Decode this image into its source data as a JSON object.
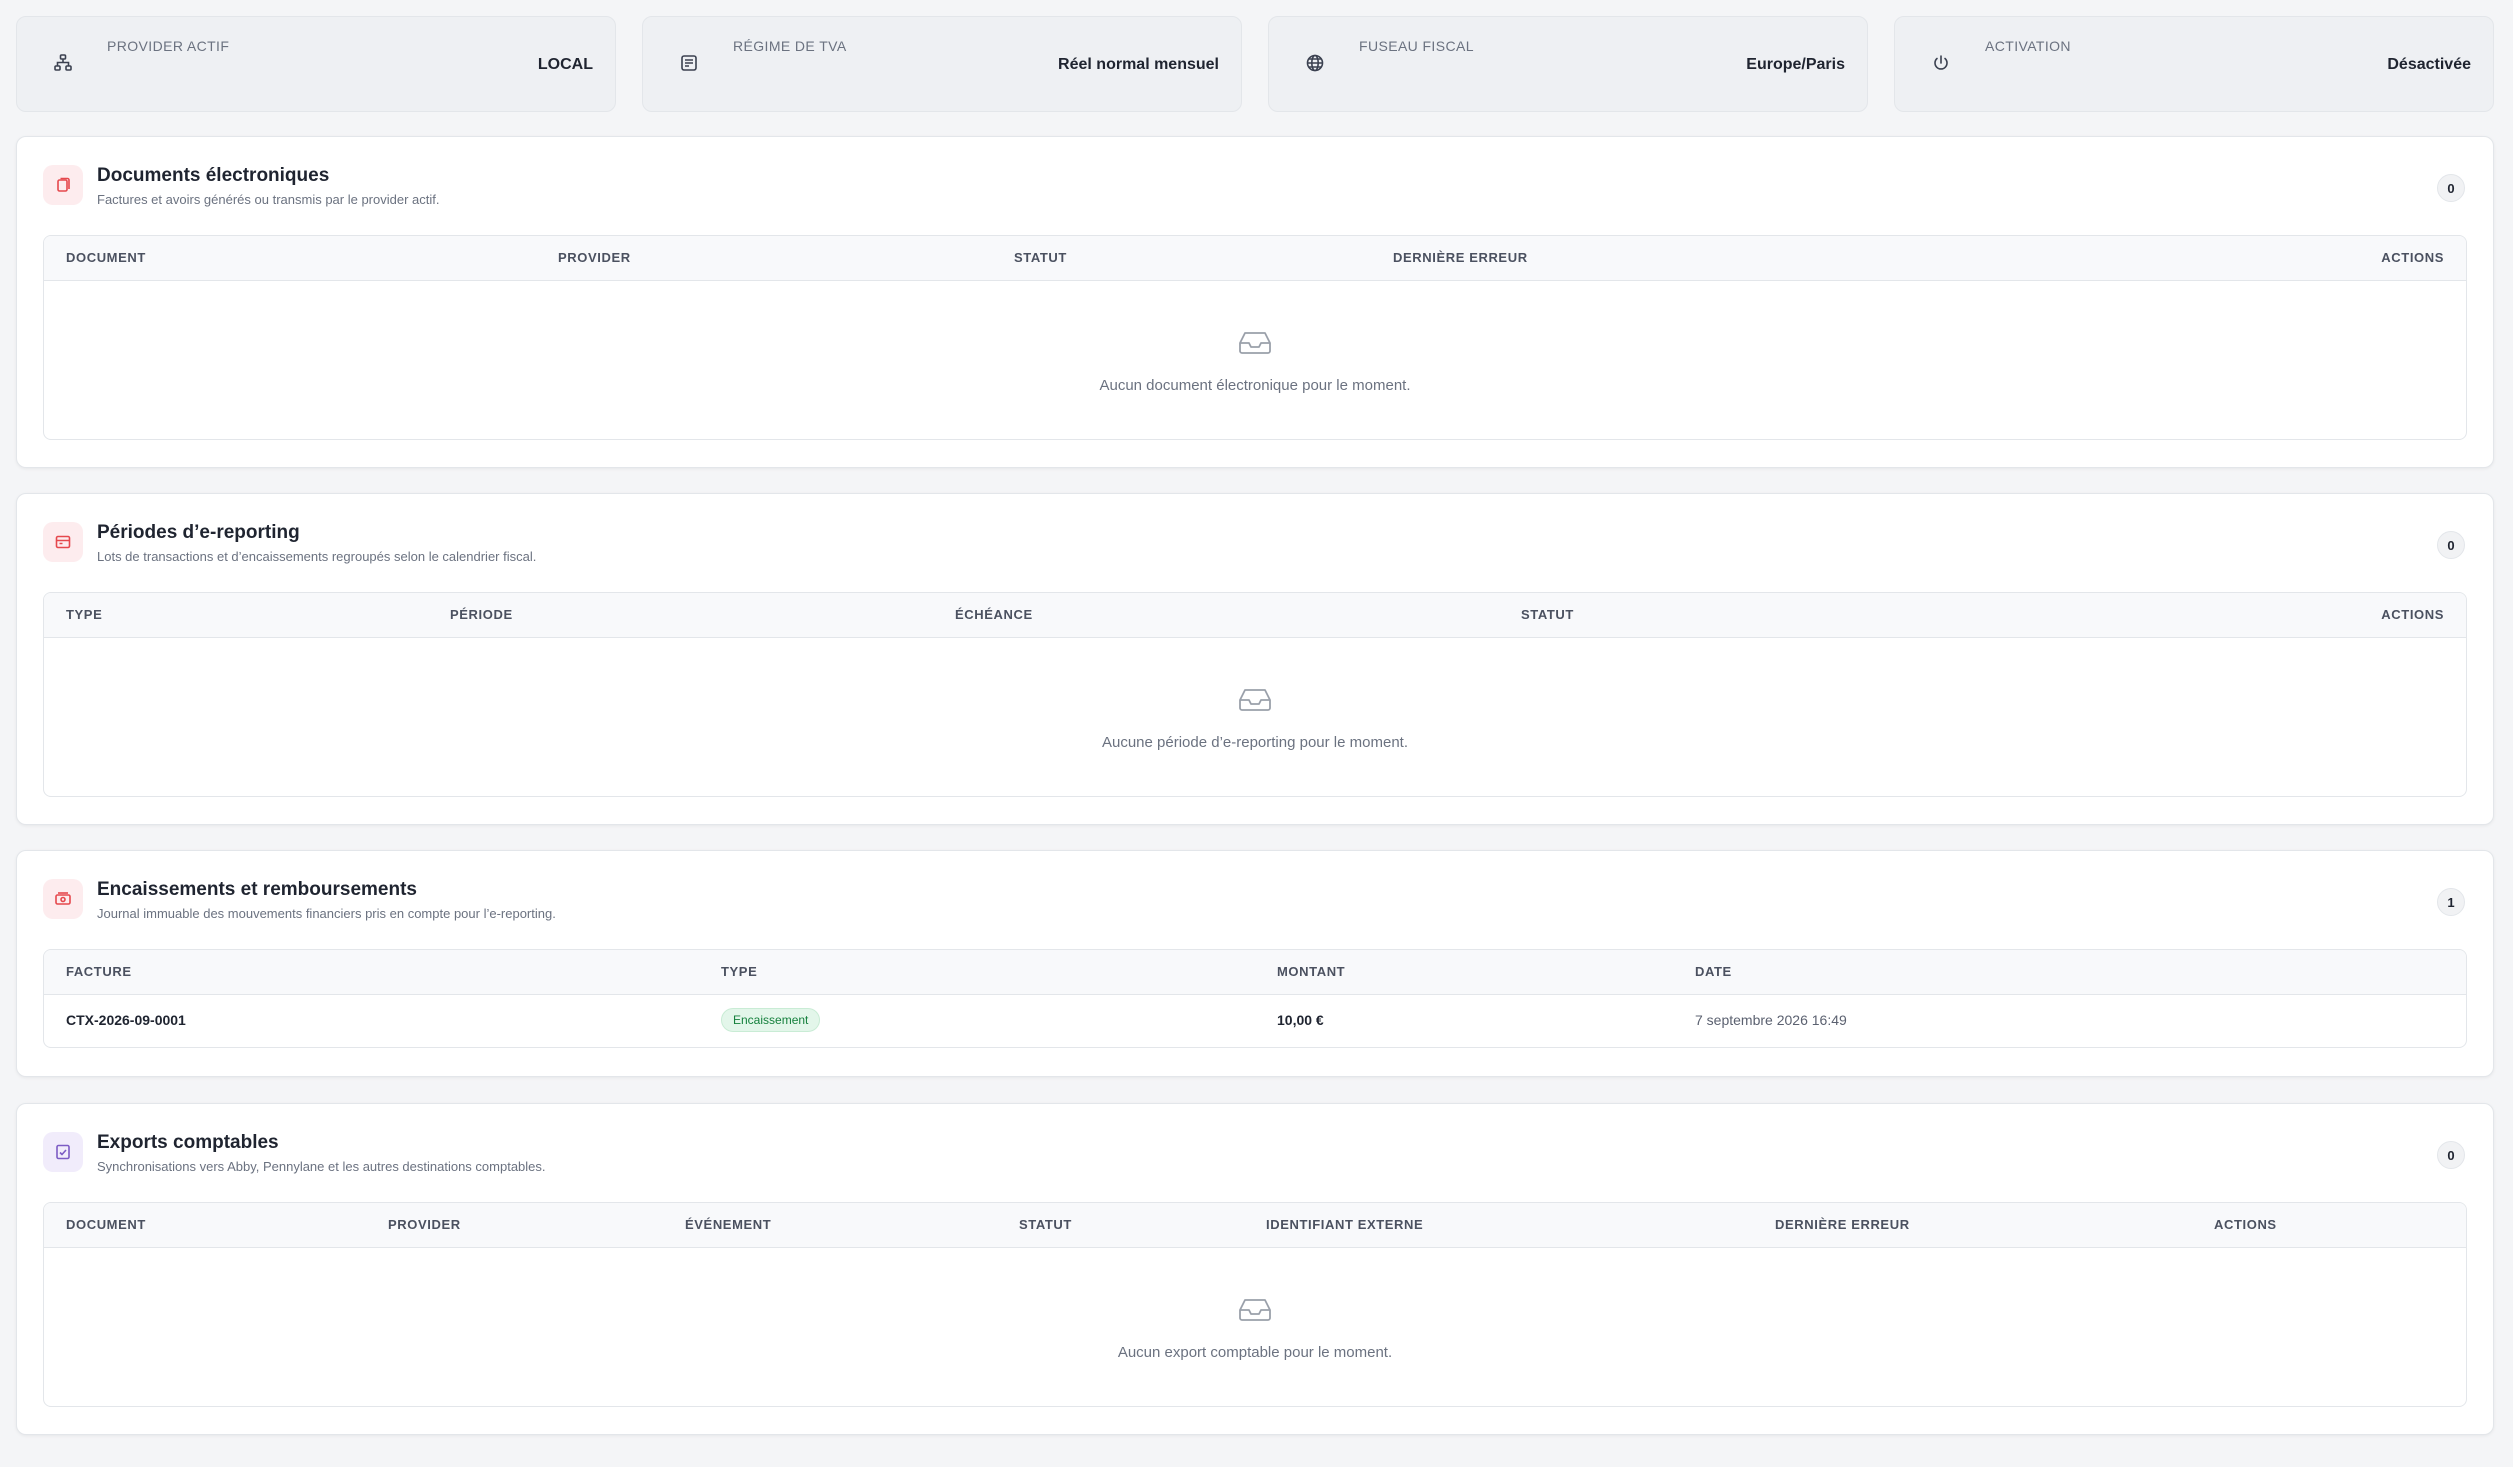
{
  "stats": [
    {
      "icon": "sitemap-icon",
      "label": "PROVIDER ACTIF",
      "value": "LOCAL"
    },
    {
      "icon": "invoice-icon",
      "label": "RÉGIME DE TVA",
      "value": "Réel normal mensuel"
    },
    {
      "icon": "globe-icon",
      "label": "FUSEAU FISCAL",
      "value": "Europe/Paris"
    },
    {
      "icon": "power-icon",
      "label": "ACTIVATION",
      "value": "Désactivée"
    }
  ],
  "documents": {
    "title": "Documents électroniques",
    "subtitle": "Factures et avoirs générés ou transmis par le provider actif.",
    "count": "0",
    "columns": [
      "DOCUMENT",
      "PROVIDER",
      "STATUT",
      "DERNIÈRE ERREUR",
      "ACTIONS"
    ],
    "empty": "Aucun document électronique pour le moment."
  },
  "periods": {
    "title": "Périodes d’e-reporting",
    "subtitle": "Lots de transactions et d’encaissements regroupés selon le calendrier fiscal.",
    "count": "0",
    "columns": [
      "TYPE",
      "PÉRIODE",
      "ÉCHÉANCE",
      "STATUT",
      "ACTIONS"
    ],
    "empty": "Aucune période d’e-reporting pour le moment."
  },
  "payments": {
    "title": "Encaissements et remboursements",
    "subtitle": "Journal immuable des mouvements financiers pris en compte pour l’e-reporting.",
    "count": "1",
    "columns": [
      "FACTURE",
      "TYPE",
      "MONTANT",
      "DATE"
    ],
    "rows": [
      {
        "invoice": "CTX-2026-09-0001",
        "type": "Encaissement",
        "amount": "10,00 €",
        "date": "7 septembre 2026 16:49"
      }
    ]
  },
  "exports": {
    "title": "Exports comptables",
    "subtitle": "Synchronisations vers Abby, Pennylane et les autres destinations comptables.",
    "count": "0",
    "columns": [
      "DOCUMENT",
      "PROVIDER",
      "ÉVÉNEMENT",
      "STATUT",
      "IDENTIFIANT EXTERNE",
      "DERNIÈRE ERREUR",
      "ACTIONS"
    ],
    "empty": "Aucun export comptable pour le moment."
  },
  "colors": {
    "accent_red": "#e5484d",
    "accent_purple": "#7c5cc4",
    "badge_green": "#15803d"
  }
}
